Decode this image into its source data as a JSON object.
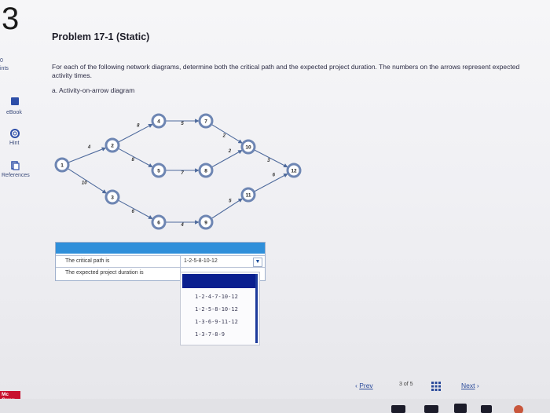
{
  "question_number": "3",
  "sidebar": {
    "points_label": "ints",
    "points_value": "0",
    "items": [
      {
        "label": "eBook",
        "icon": "book-icon"
      },
      {
        "label": "Hint",
        "icon": "lifebuoy-icon"
      },
      {
        "label": "References",
        "icon": "reference-icon"
      }
    ]
  },
  "problem": {
    "title": "Problem 17-1 (Static)",
    "instructions": "For each of the following network diagrams, determine both the critical path and the expected project duration. The numbers on the arrows represent expected activity times.",
    "part_a": "a. Activity-on-arrow diagram"
  },
  "diagram": {
    "nodes": [
      "1",
      "2",
      "3",
      "4",
      "5",
      "6",
      "7",
      "8",
      "9",
      "10",
      "11",
      "12"
    ],
    "edges": [
      {
        "from": "1",
        "to": "2",
        "time": "4"
      },
      {
        "from": "1",
        "to": "3",
        "time": "10"
      },
      {
        "from": "2",
        "to": "4",
        "time": "8"
      },
      {
        "from": "2",
        "to": "5",
        "time": "8"
      },
      {
        "from": "3",
        "to": "6",
        "time": "6"
      },
      {
        "from": "4",
        "to": "7",
        "time": "5"
      },
      {
        "from": "5",
        "to": "8",
        "time": "7"
      },
      {
        "from": "6",
        "to": "9",
        "time": "4"
      },
      {
        "from": "7",
        "to": "10",
        "time": "2"
      },
      {
        "from": "8",
        "to": "10",
        "time": "2"
      },
      {
        "from": "9",
        "to": "11",
        "time": "5"
      },
      {
        "from": "10",
        "to": "12",
        "time": "3"
      },
      {
        "from": "11",
        "to": "12",
        "time": "6"
      }
    ]
  },
  "answers": {
    "critical_path_label": "The critical path is",
    "critical_path_value": "1-2-5-8-10-12",
    "duration_label": "The expected project duration is",
    "duration_value": ""
  },
  "dropdown_options": [
    "1-2-4-7-10-12",
    "1-2-5-8-10-12",
    "1-3-6-9-11-12",
    "1-3-7-8-9"
  ],
  "pagination": {
    "prev": "Prev",
    "current": "3",
    "of": "of",
    "total": "5",
    "next": "Next"
  },
  "logo_text": "Mc Graw Hill",
  "colors": {
    "accent": "#2f8fda",
    "node_stroke": "#6e86b3",
    "dropdown_selected": "#0a1f8f",
    "logo": "#c8102e"
  }
}
